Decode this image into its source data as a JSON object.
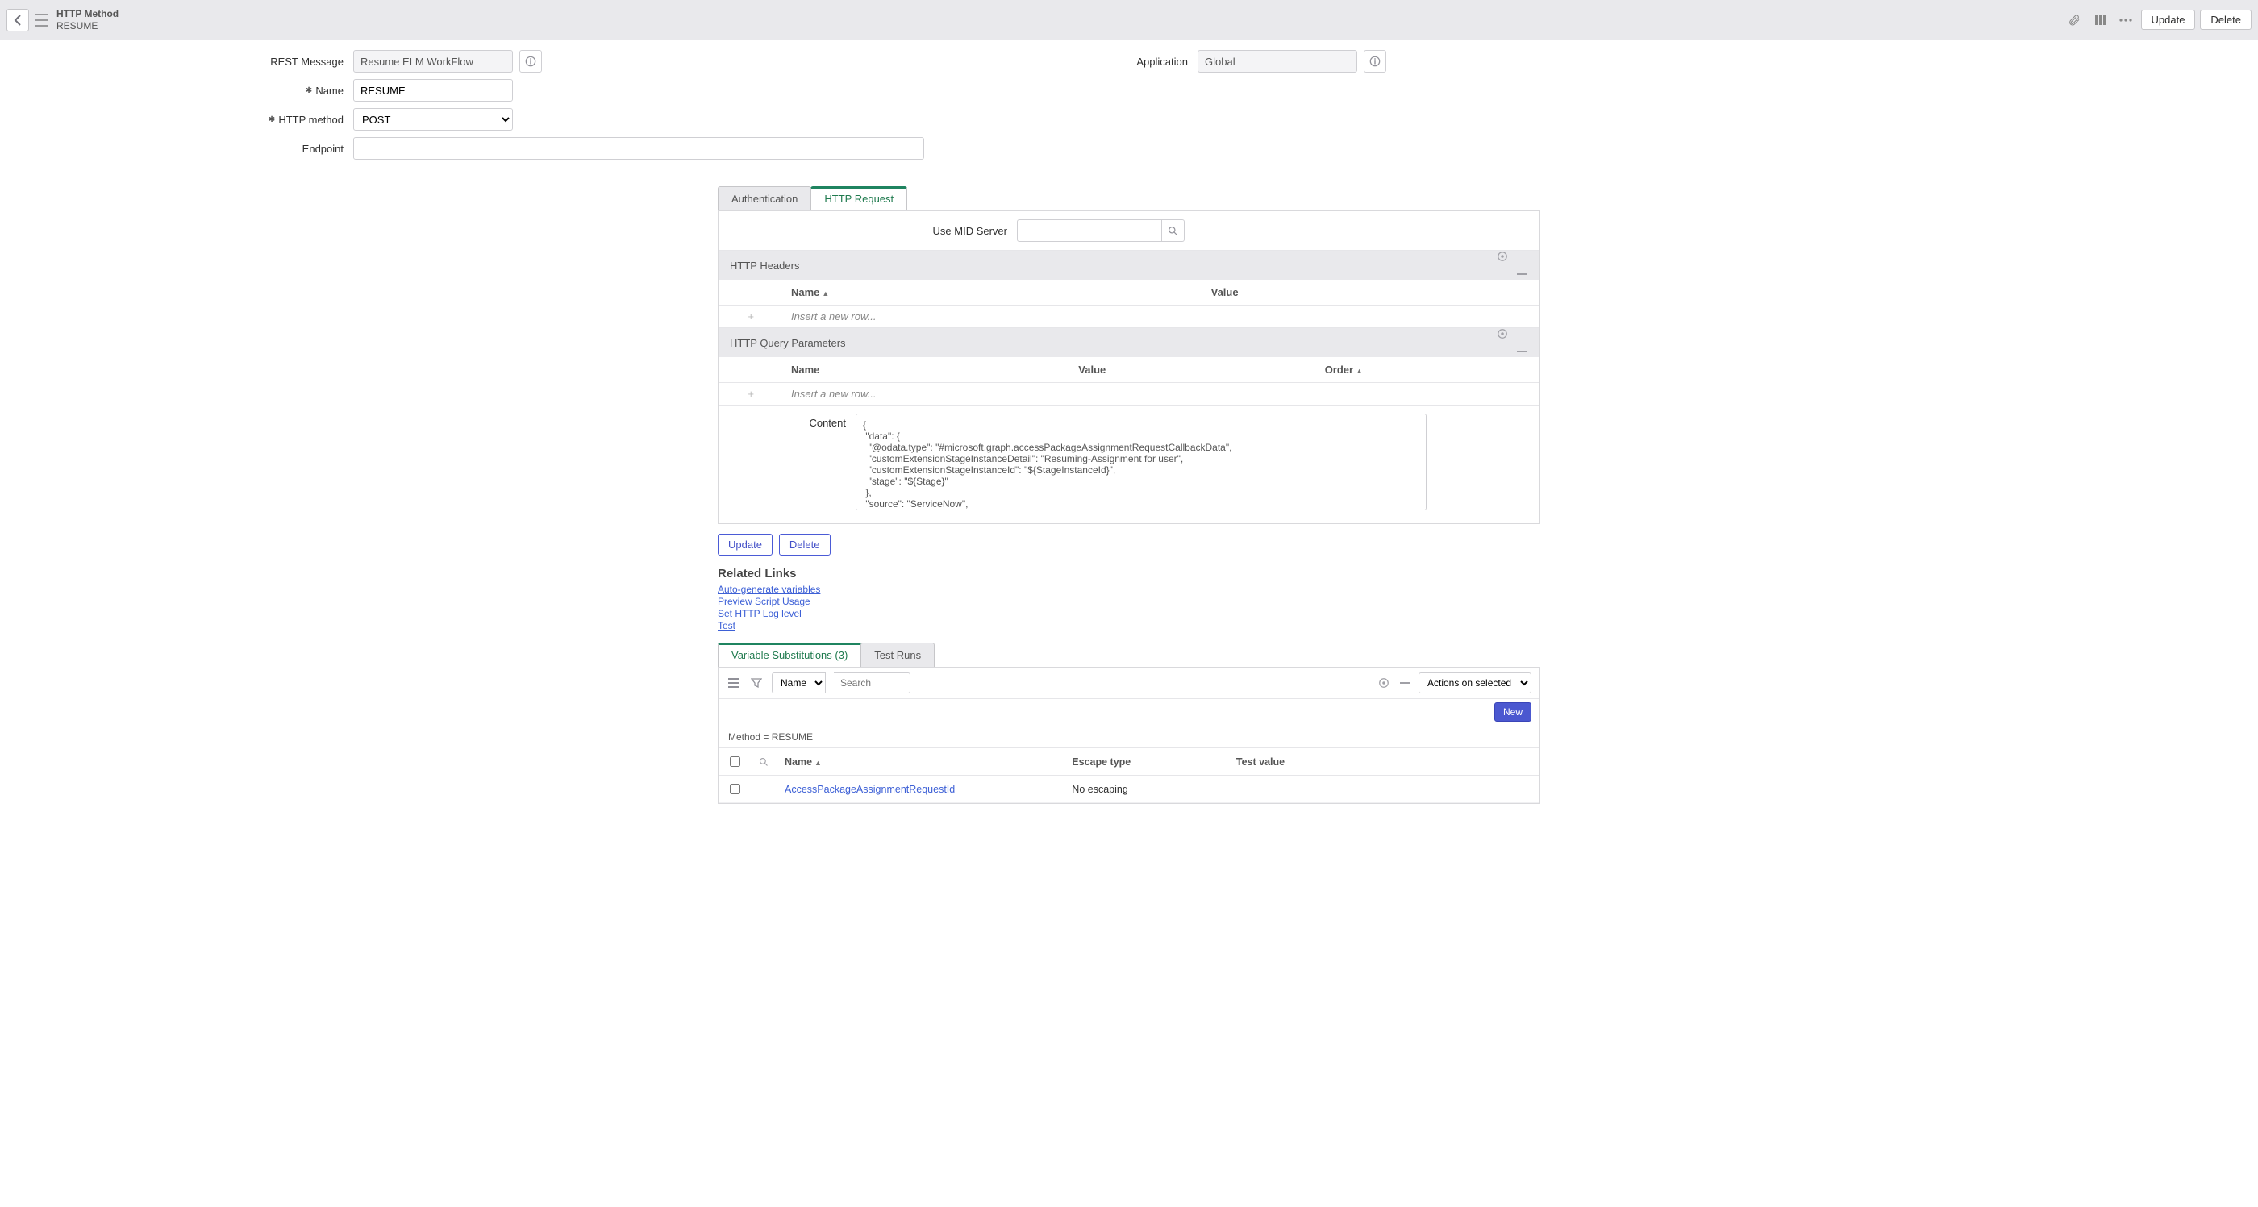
{
  "header": {
    "record_type": "HTTP Method",
    "record_name": "RESUME",
    "update_btn": "Update",
    "delete_btn": "Delete"
  },
  "form": {
    "rest_message_label": "REST Message",
    "rest_message_value": "Resume ELM WorkFlow",
    "name_label": "Name",
    "name_value": "RESUME",
    "http_method_label": "HTTP method",
    "http_method_value": "POST",
    "endpoint_label": "Endpoint",
    "endpoint_value": "",
    "application_label": "Application",
    "application_value": "Global"
  },
  "tabs": {
    "auth": "Authentication",
    "http_request": "HTTP Request"
  },
  "mid": {
    "label": "Use MID Server",
    "value": ""
  },
  "sections": {
    "headers_title": "HTTP Headers",
    "query_title": "HTTP Query Parameters",
    "insert_hint": "Insert a new row..."
  },
  "headers_cols": {
    "name": "Name",
    "value": "Value"
  },
  "query_cols": {
    "name": "Name",
    "value": "Value",
    "order": "Order"
  },
  "content": {
    "label": "Content",
    "value": "{\n \"data\": {\n  \"@odata.type\": \"#microsoft.graph.accessPackageAssignmentRequestCallbackData\",\n  \"customExtensionStageInstanceDetail\": \"Resuming-Assignment for user\",\n  \"customExtensionStageInstanceId\": \"${StageInstanceId}\",\n  \"stage\": \"${Stage}\"\n },\n \"source\": \"ServiceNow\",\n \"type\": \"microsoft.graph.accessPackageCustomExtensionStage.${Stage}\"\n}"
  },
  "buttons": {
    "update": "Update",
    "delete": "Delete"
  },
  "related": {
    "title": "Related Links",
    "link1": "Auto-generate variables",
    "link2": "Preview Script Usage",
    "link3": "Set HTTP Log level",
    "link4": "Test"
  },
  "tabs2": {
    "varsub": "Variable Substitutions (3)",
    "testruns": "Test Runs"
  },
  "list": {
    "search_field": "Name",
    "search_placeholder": "Search",
    "actions_placeholder": "Actions on selected rows...",
    "new_btn": "New",
    "filter_crumb_key": "Method",
    "filter_crumb_val": "RESUME",
    "cols": {
      "name": "Name",
      "escape": "Escape type",
      "test": "Test value"
    },
    "rows": [
      {
        "name": "AccessPackageAssignmentRequestId",
        "escape": "No escaping",
        "test": ""
      }
    ]
  }
}
